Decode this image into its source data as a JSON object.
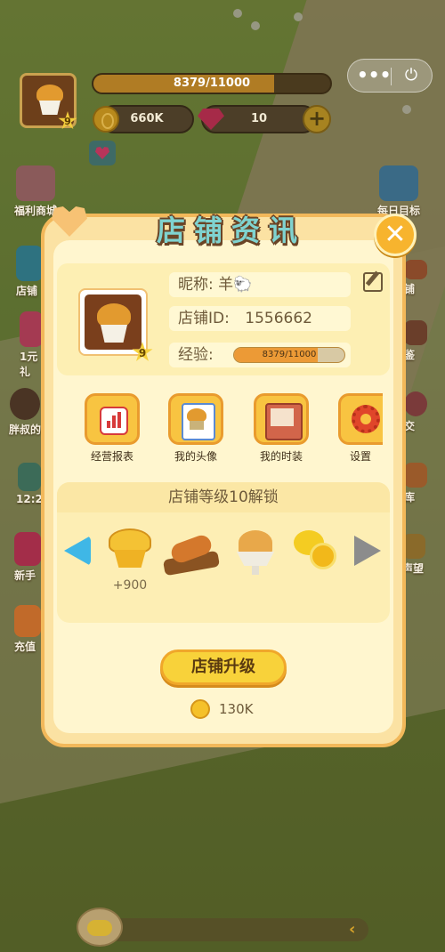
{
  "hud": {
    "exp_text": "8379/11000",
    "exp_fraction": 0.762,
    "avatar_level": "9",
    "coins": "660K",
    "gems": "10",
    "plus": "+"
  },
  "capsule": {
    "more": "•••",
    "power": "⏻"
  },
  "side_left": [
    {
      "label": "福利商城"
    },
    {
      "label": "店铺"
    },
    {
      "label": "1元"
    },
    {
      "label": "礼"
    },
    {
      "label": "胖叔的"
    },
    {
      "label": "12:2"
    },
    {
      "label": "新手"
    },
    {
      "label": "充值"
    }
  ],
  "side_right": [
    {
      "label": "每日目标"
    },
    {
      "label": "铺"
    },
    {
      "label": "鉴"
    },
    {
      "label": "交"
    },
    {
      "label": "库"
    },
    {
      "label": "声望"
    }
  ],
  "modal": {
    "title": "店铺资讯",
    "close": "✕",
    "nickname_label": "昵称: 羊🐑",
    "shop_id_label": "店铺ID:",
    "shop_id_value": "1556662",
    "exp_label": "经验:",
    "exp_text": "8379/11000",
    "exp_fraction": 0.762,
    "shop_level": "9",
    "actions": [
      {
        "label": "经营报表"
      },
      {
        "label": "我的头像"
      },
      {
        "label": "我的时装"
      },
      {
        "label": "设置"
      }
    ],
    "unlock_title": "店铺等级10解锁",
    "reward_value": "+900",
    "upgrade_label": "店铺升级",
    "upgrade_cost": "130K"
  },
  "colors": {
    "title_fill": "#7fd3d0",
    "title_stroke": "#6a4426",
    "button_yellow": "#f8c441",
    "panel_cream": "#fff6cf"
  }
}
